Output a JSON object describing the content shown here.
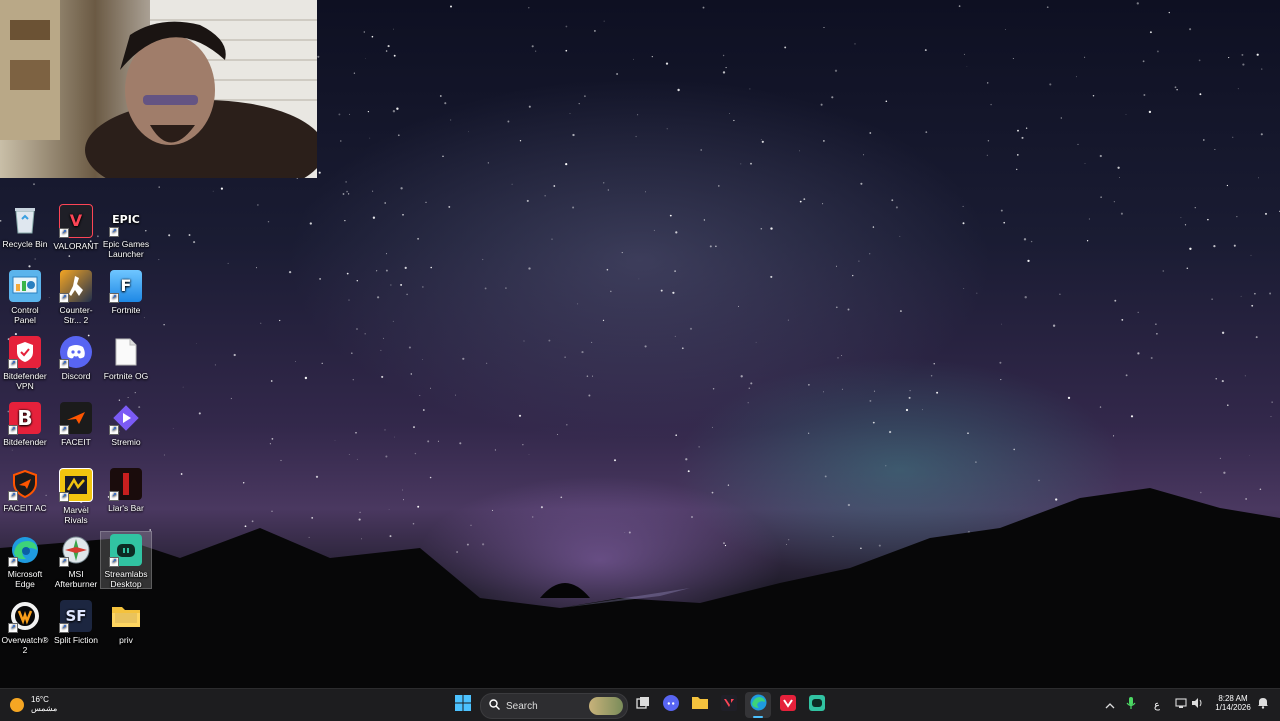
{
  "desktop": {
    "icons": [
      {
        "label": "Recycle Bin"
      },
      {
        "label": "VALORANT"
      },
      {
        "label": "Epic Games Launcher"
      },
      {
        "label": "Control Panel"
      },
      {
        "label": "Counter-Str... 2"
      },
      {
        "label": "Fortnite"
      },
      {
        "label": "Bitdefender VPN"
      },
      {
        "label": "Discord"
      },
      {
        "label": "Fortnite OG"
      },
      {
        "label": "Bitdefender"
      },
      {
        "label": "FACEIT"
      },
      {
        "label": "Stremio"
      },
      {
        "label": "FACEIT AC"
      },
      {
        "label": "Marvel Rivals"
      },
      {
        "label": "Liar's Bar"
      },
      {
        "label": "Microsoft Edge"
      },
      {
        "label": "MSI Afterburner"
      },
      {
        "label": "Streamlabs Desktop"
      },
      {
        "label": "Overwatch® 2"
      },
      {
        "label": "Split Fiction"
      },
      {
        "label": "priv"
      }
    ],
    "epic_logo_text": "EPIC"
  },
  "taskbar": {
    "weather_temp": "16°C",
    "weather_desc": "مشمس",
    "search_placeholder": "Search",
    "language": "ع",
    "time": "8:28 AM",
    "date": "1/14/2026"
  },
  "colors": {
    "taskbar_bg": "#1d1d1f",
    "accent": "#0078d4"
  }
}
